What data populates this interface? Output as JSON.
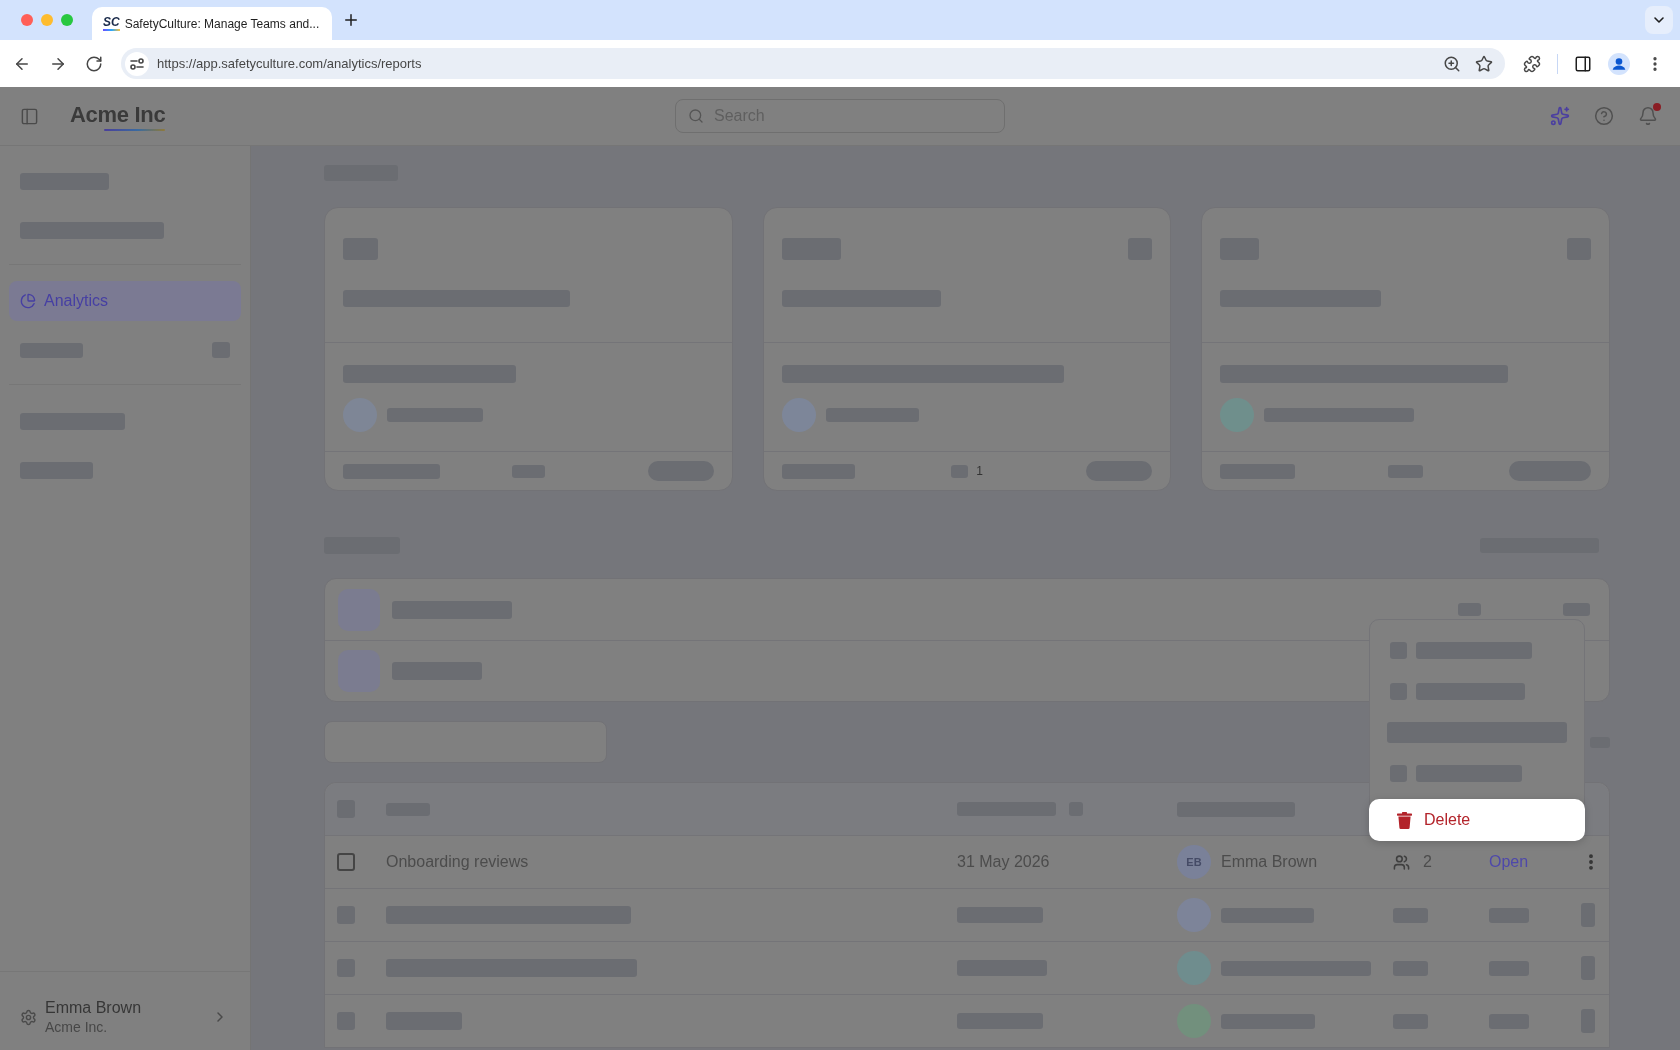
{
  "browser": {
    "tabs": [
      {
        "favicon": "SC",
        "title": "SafetyCulture: Manage Teams and...",
        "selected": true
      }
    ],
    "url": "https://app.safetyculture.com/analytics/reports"
  },
  "header": {
    "logo": "Acme Inc",
    "search": {
      "placeholder": "Search"
    },
    "notifications_unread": true
  },
  "sidebar": {
    "groups": [
      {
        "items": [
          {
            "kind": "blurred",
            "selected": false
          },
          {
            "kind": "blurred",
            "selected": false
          }
        ]
      },
      {
        "items": [
          {
            "kind": "link",
            "label": "Analytics",
            "selected": true
          },
          {
            "kind": "blurred_badge",
            "selected": false
          }
        ]
      },
      {
        "items": [
          {
            "kind": "blurred",
            "selected": false
          },
          {
            "kind": "blurred",
            "selected": false
          }
        ]
      }
    ],
    "user": {
      "name": "Emma Brown",
      "org": "Acme Inc."
    }
  },
  "cards": [
    {
      "kind": "plain",
      "color": "#7e8696"
    },
    {
      "kind": "with_icon",
      "color": "#7d8699",
      "count": "1"
    },
    {
      "kind": "with_icon",
      "color": "#6f8f8c"
    }
  ],
  "list": {
    "rows": [
      {
        "kind": "blurred_meta"
      },
      {
        "kind": "blurred"
      }
    ]
  },
  "table": {
    "rows": [
      {
        "kind": "record",
        "checked": false,
        "name": "Onboarding reviews",
        "date": "31 May 2026",
        "owner": {
          "initials": "EB",
          "name": "Emma Brown"
        },
        "members": "2",
        "action": "Open"
      },
      {
        "kind": "blurred",
        "color": "#7d8499"
      },
      {
        "kind": "blurred",
        "color": "#6f8d8e"
      },
      {
        "kind": "blurred",
        "color": "#72907d"
      }
    ]
  },
  "menu": {
    "items": [
      {
        "kind": "blurred",
        "selected": false
      },
      {
        "kind": "blurred",
        "selected": false
      },
      {
        "kind": "blurred_wide",
        "selected": false
      },
      {
        "kind": "blurred",
        "selected": false
      },
      {
        "kind": "action",
        "label": "Delete",
        "danger": true,
        "selected": true
      }
    ]
  }
}
